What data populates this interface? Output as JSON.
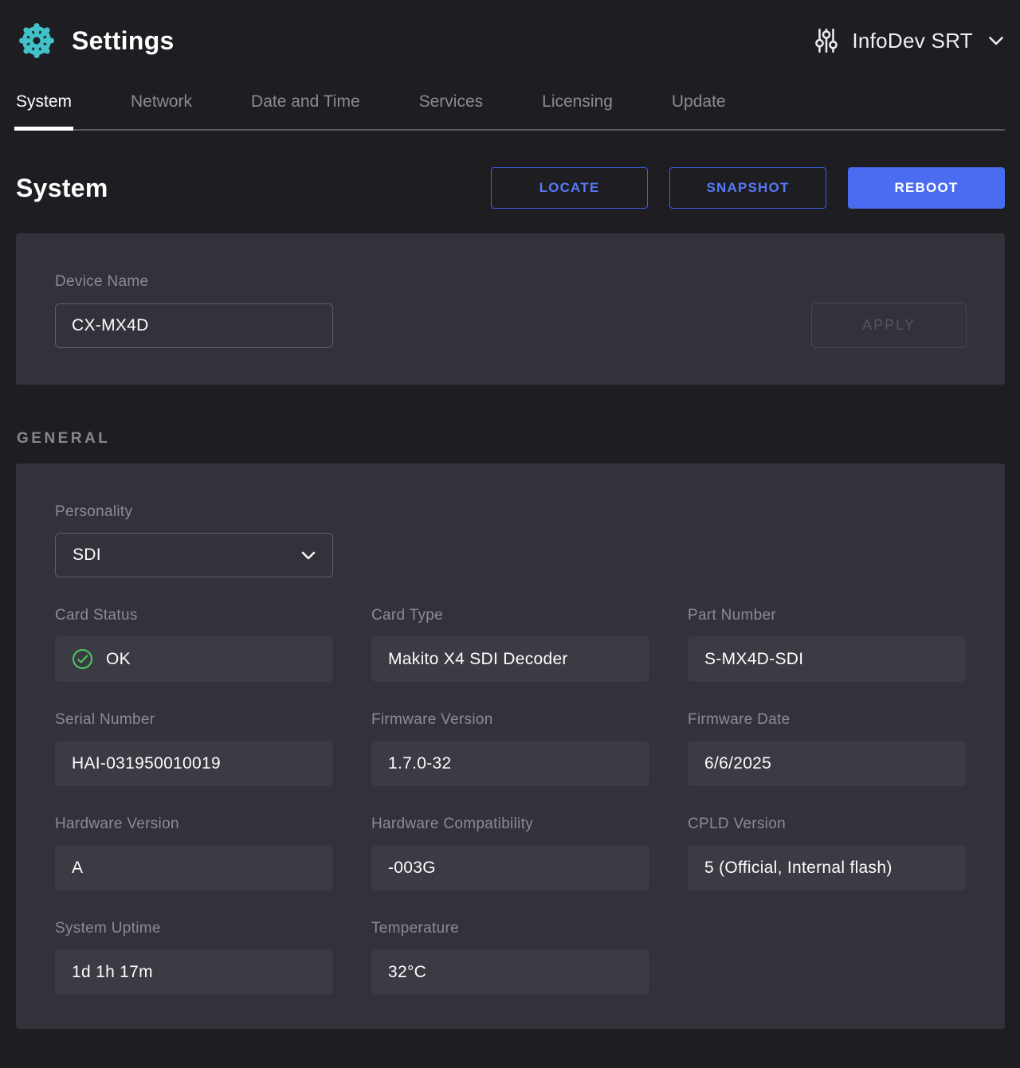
{
  "header": {
    "title": "Settings",
    "preset_label": "InfoDev SRT"
  },
  "tabs": [
    {
      "label": "System",
      "active": true
    },
    {
      "label": "Network",
      "active": false
    },
    {
      "label": "Date and Time",
      "active": false
    },
    {
      "label": "Services",
      "active": false
    },
    {
      "label": "Licensing",
      "active": false
    },
    {
      "label": "Update",
      "active": false
    }
  ],
  "page": {
    "title": "System",
    "locate_label": "LOCATE",
    "snapshot_label": "SNAPSHOT",
    "reboot_label": "REBOOT"
  },
  "device_name": {
    "label": "Device Name",
    "value": "CX-MX4D",
    "apply_label": "APPLY"
  },
  "general": {
    "section_label": "GENERAL",
    "personality_label": "Personality",
    "personality_value": "SDI",
    "fields": [
      {
        "label": "Card Status",
        "value": "OK",
        "status": "ok"
      },
      {
        "label": "Card Type",
        "value": "Makito X4 SDI Decoder"
      },
      {
        "label": "Part Number",
        "value": "S-MX4D-SDI"
      },
      {
        "label": "Serial Number",
        "value": "HAI-031950010019"
      },
      {
        "label": "Firmware Version",
        "value": "1.7.0-32"
      },
      {
        "label": "Firmware Date",
        "value": "6/6/2025"
      },
      {
        "label": "Hardware Version",
        "value": "A"
      },
      {
        "label": "Hardware Compatibility",
        "value": "-003G"
      },
      {
        "label": "CPLD Version",
        "value": "5 (Official, Internal flash)"
      },
      {
        "label": "System Uptime",
        "value": "1d 1h 17m"
      },
      {
        "label": "Temperature",
        "value": "32°C"
      }
    ]
  },
  "colors": {
    "page_bg": "#1e1e22",
    "card_bg": "#32323a",
    "field_bg": "#3b3b44",
    "accent_blue": "#4a6cf0",
    "outline_blue_border": "#3d5fe8",
    "outline_blue_text": "#5679f4",
    "teal_icon": "#41c1c8",
    "status_green": "#4cc95d",
    "label_gray": "#8b8b94"
  }
}
